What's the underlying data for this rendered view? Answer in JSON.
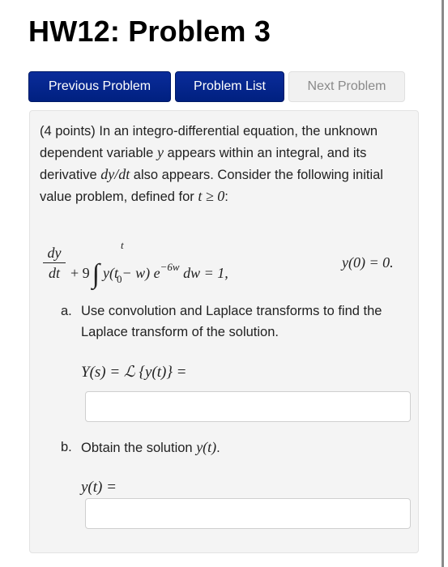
{
  "page": {
    "title": "HW12: Problem 3"
  },
  "nav": {
    "previous_label": "Previous Problem",
    "list_label": "Problem List",
    "next_label": "Next Problem",
    "next_disabled": true
  },
  "problem": {
    "intro_part1": "(4 points) In an integro-differential equation, the unknown dependent variable ",
    "intro_var": "y",
    "intro_part2": " appears within an integral, and its derivative ",
    "intro_deriv": "dy/dt",
    "intro_part3": " also appears. Consider the following initial value problem, defined for ",
    "intro_domain": "t ≥ 0",
    "intro_part4": ":",
    "equation": {
      "frac_num": "dy",
      "frac_den": "dt",
      "plus_coef": "+ 9",
      "integral_symbol": "∫",
      "upper_limit": "t",
      "lower_limit": "0",
      "integrand": "y(t − w) e",
      "exponent": "−6w",
      "differential": " dw = 1,",
      "initial_condition": "y(0) = 0."
    },
    "parts": [
      {
        "label": "a.",
        "text": "Use convolution and Laplace transforms to find the Laplace transform of the solution.",
        "answer_label": "Y(s) = ℒ {y(t)} =",
        "answer_value": "",
        "answer_placeholder": ""
      },
      {
        "label": "b.",
        "text_prefix": "Obtain the solution ",
        "text_math": "y(t)",
        "text_suffix": ".",
        "answer_label": "y(t) =",
        "answer_value": "",
        "answer_placeholder": ""
      }
    ]
  },
  "colors": {
    "primary_button": "#0a2c9a",
    "disabled_button": "#f1f1f1",
    "panel_background": "#f4f4f4"
  }
}
